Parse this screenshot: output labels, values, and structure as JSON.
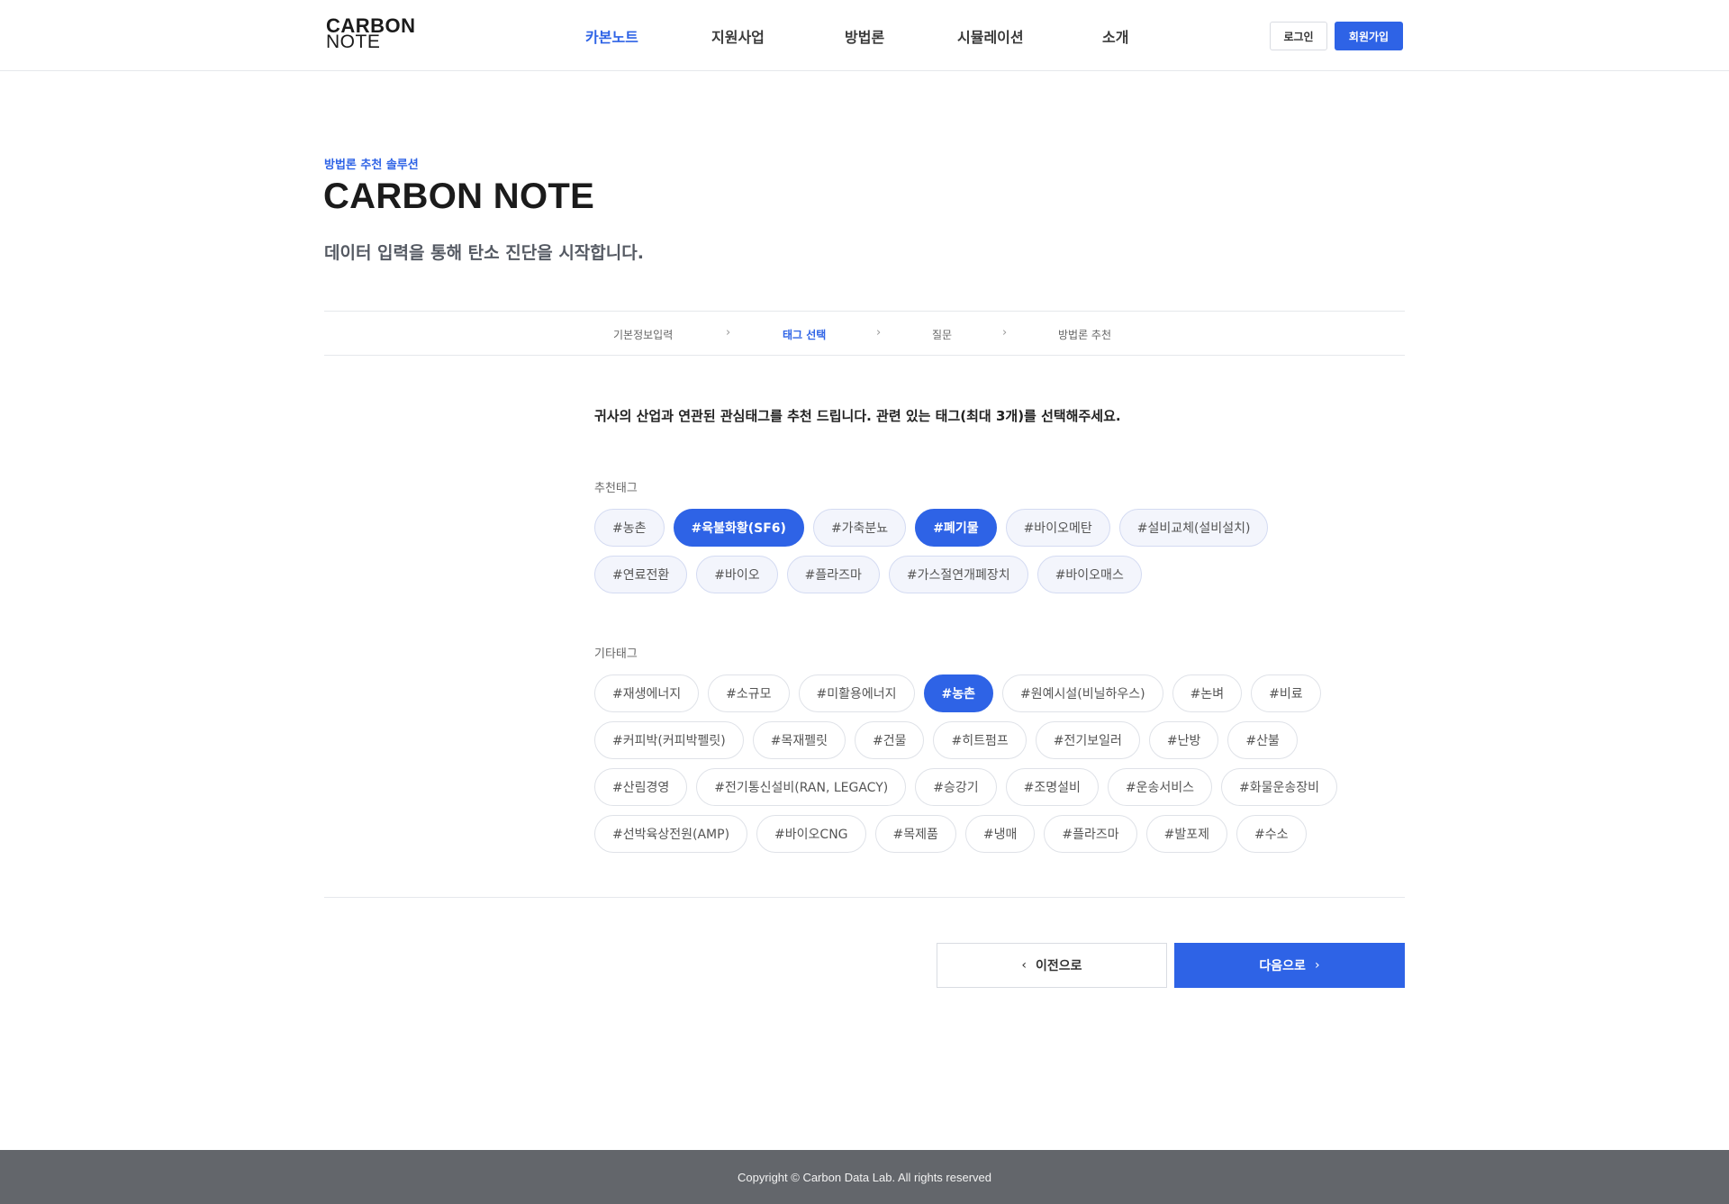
{
  "header": {
    "logo_line1": "CARBON",
    "logo_line2": "NOTE",
    "nav": [
      "카본노트",
      "지원사업",
      "방법론",
      "시뮬레이션",
      "소개"
    ],
    "login_label": "로그인",
    "join_label": "회원가입"
  },
  "hero": {
    "eyebrow": "방법론 추천 솔루션",
    "title": "CARBON NOTE",
    "subtitle": "데이터 입력을 통해 탄소 진단을 시작합니다."
  },
  "steps": [
    "기본정보입력",
    "태그 선택",
    "질문",
    "방법론 추천"
  ],
  "instruction": "귀사의 산업과 연관된 관심태그를 추천 드립니다.  관련 있는 태그(최대 3개)를 선택해주세요.",
  "recommended": {
    "label": "추천태그",
    "rows": [
      [
        "#농촌",
        "#육불화황(SF6)",
        "#가축분뇨",
        "#폐기물",
        "#바이오메탄",
        "#설비교체(설비설치)"
      ],
      [
        "#연료전환",
        "#바이오",
        "#플라즈마",
        "#가스절연개폐장치",
        "#바이오매스"
      ]
    ]
  },
  "others": {
    "label": "기타태그",
    "rows": [
      [
        "#재생에너지",
        "#소규모",
        "#미활용에너지",
        "#농촌",
        "#원예시설(비닐하우스)",
        "#논벼",
        "#비료"
      ],
      [
        "#커피박(커피박펠릿)",
        "#목재펠릿",
        "#건물",
        "#히트펌프",
        "#전기보일러",
        "#난방",
        "#산불"
      ],
      [
        "#산림경영",
        "#전기통신설비(RAN, LEGACY)",
        "#승강기",
        "#조명설비",
        "#운송서비스",
        "#화물운송장비"
      ],
      [
        "#선박육상전원(AMP)",
        "#바이오CNG",
        "#목제품",
        "#냉매",
        "#플라즈마",
        "#발포제",
        "#수소"
      ]
    ]
  },
  "buttons": {
    "prev_label": "이전으로",
    "next_label": "다음으로"
  },
  "footer": "Copyright © Carbon Data Lab. All rights reserved",
  "colors": {
    "accent": "#2e63e6",
    "footer_bg": "#63666b"
  }
}
